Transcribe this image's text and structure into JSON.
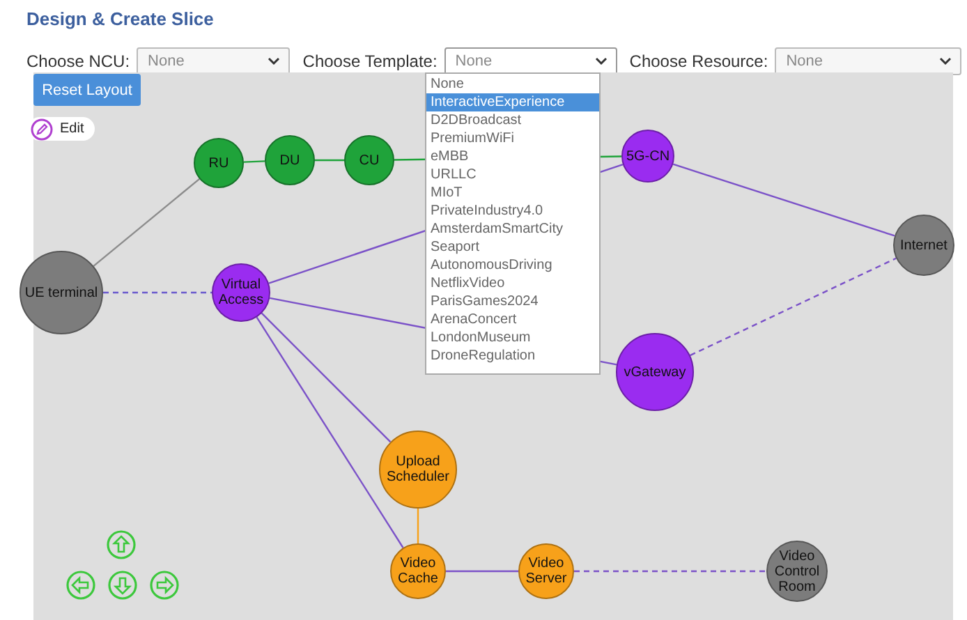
{
  "title": "Design & Create Slice",
  "selects": [
    {
      "label": "Choose NCU:",
      "value": "None",
      "open": false
    },
    {
      "label": "Choose Template:",
      "value": "None",
      "open": true
    },
    {
      "label": "Choose Resource:",
      "value": "None",
      "open": false
    }
  ],
  "template_options": [
    {
      "label": "None",
      "selected": false
    },
    {
      "label": "InteractiveExperience",
      "selected": true
    },
    {
      "label": "D2DBroadcast",
      "selected": false
    },
    {
      "label": "PremiumWiFi",
      "selected": false
    },
    {
      "label": "eMBB",
      "selected": false
    },
    {
      "label": "URLLC",
      "selected": false
    },
    {
      "label": "MIoT",
      "selected": false
    },
    {
      "label": "PrivateIndustry4.0",
      "selected": false
    },
    {
      "label": "AmsterdamSmartCity",
      "selected": false
    },
    {
      "label": "Seaport",
      "selected": false
    },
    {
      "label": "AutonomousDriving",
      "selected": false
    },
    {
      "label": "NetflixVideo",
      "selected": false
    },
    {
      "label": "ParisGames2024",
      "selected": false
    },
    {
      "label": "ArenaConcert",
      "selected": false
    },
    {
      "label": "LondonMuseum",
      "selected": false
    },
    {
      "label": "DroneRegulation",
      "selected": false
    }
  ],
  "reset_button": "Reset Layout",
  "edit_button": "Edit",
  "nodes": [
    {
      "label": "RU",
      "color": "#1fa33a"
    },
    {
      "label": "DU",
      "color": "#1fa33a"
    },
    {
      "label": "CU",
      "color": "#1fa33a"
    },
    {
      "label": "5G-CN",
      "color": "#9a2cf0"
    },
    {
      "label": "Internet",
      "color": "#7c7c7c"
    },
    {
      "label": "UE terminal",
      "color": "#7c7c7c"
    },
    {
      "label": "Virtual Access",
      "color": "#9a2cf0"
    },
    {
      "label": "vGateway",
      "color": "#9a2cf0"
    },
    {
      "label": "Upload Scheduler",
      "color": "#f7a11a"
    },
    {
      "label": "Video Cache",
      "color": "#f7a11a"
    },
    {
      "label": "Video Server",
      "color": "#f7a11a"
    },
    {
      "label": "Video Control Room",
      "color": "#7c7c7c"
    }
  ]
}
